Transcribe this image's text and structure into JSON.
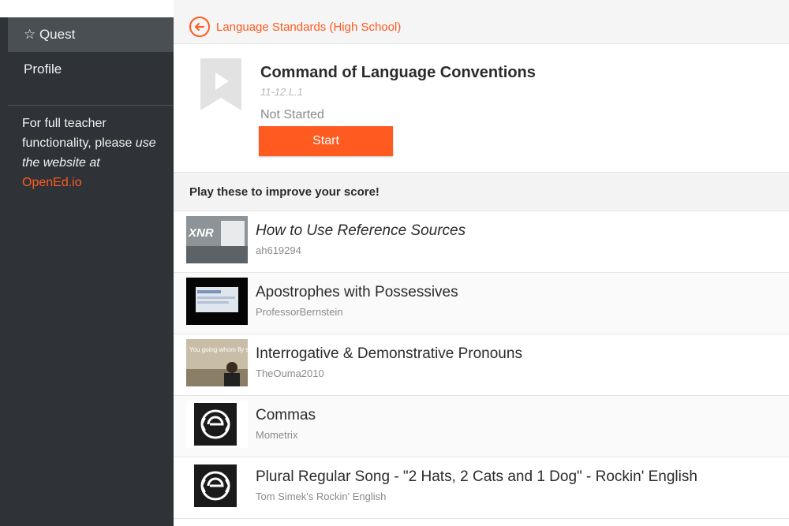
{
  "sidebar": {
    "items": [
      {
        "label": "☆ Quest"
      },
      {
        "label": "Profile"
      }
    ],
    "note": {
      "line1": "For full teacher functionality, please",
      "line2": "use the website at",
      "link": "OpenEd.io"
    }
  },
  "breadcrumb": {
    "label": "Language Standards (High School)"
  },
  "skill": {
    "title": "Command of Language Conventions",
    "code": "11-12.L.1",
    "status": "Not Started",
    "start_label": "Start"
  },
  "section": {
    "title": "Play these to improve your score!"
  },
  "videos": [
    {
      "title": "How to Use Reference Sources",
      "author": "ah619294",
      "thumb_text": "XNR"
    },
    {
      "title": "Apostrophes with Possessives",
      "author": "ProfessorBernstein"
    },
    {
      "title": "Interrogative & Demonstrative Pronouns",
      "author": "TheOuma2010",
      "thumb_text": "You going whom fly something"
    },
    {
      "title": "Commas",
      "author": "Mometrix"
    },
    {
      "title": "Plural Regular Song - \"2 Hats, 2 Cats and 1 Dog\" - Rockin' English",
      "author": "Tom Simek's Rockin' English"
    }
  ],
  "colors": {
    "accent": "#ff5a1f",
    "sidebar_bg": "#2f3337",
    "sidebar_active": "#4a4f54"
  }
}
